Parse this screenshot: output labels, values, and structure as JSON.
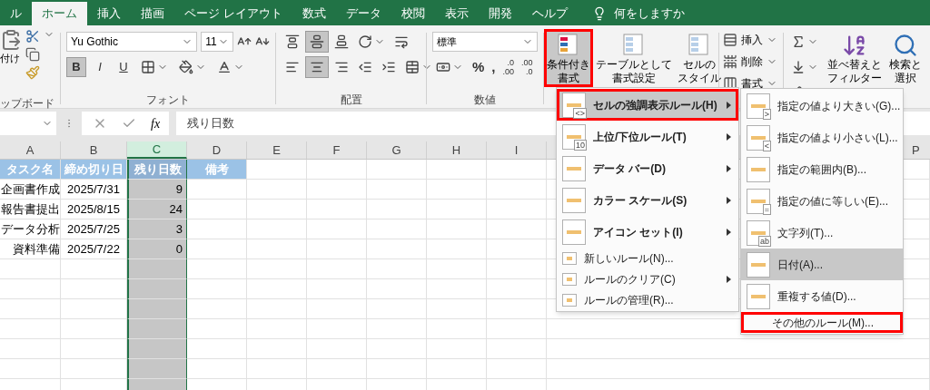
{
  "tabs": [
    {
      "label": "ル",
      "selected": false
    },
    {
      "label": "ホーム",
      "selected": true
    },
    {
      "label": "挿入",
      "selected": false
    },
    {
      "label": "描画",
      "selected": false
    },
    {
      "label": "ページ レイアウト",
      "selected": false
    },
    {
      "label": "数式",
      "selected": false
    },
    {
      "label": "データ",
      "selected": false
    },
    {
      "label": "校閲",
      "selected": false
    },
    {
      "label": "表示",
      "selected": false
    },
    {
      "label": "開発",
      "selected": false
    },
    {
      "label": "ヘルプ",
      "selected": false
    }
  ],
  "tell_me": {
    "placeholder": "何をしますか"
  },
  "ribbon": {
    "clipboard": {
      "paste_label": "付け",
      "group_label": "ップボード"
    },
    "font": {
      "name": "Yu Gothic",
      "size": "11",
      "group_label": "フォント",
      "style_buttons": [
        {
          "label": "B",
          "selected": true
        },
        {
          "label": "I",
          "selected": false
        },
        {
          "label": "U",
          "selected": false
        }
      ]
    },
    "alignment": {
      "group_label": "配置",
      "vertical_buttons": [
        {
          "selected": false
        },
        {
          "selected": true
        },
        {
          "selected": false
        }
      ],
      "horizontal_buttons": [
        {
          "selected": false
        },
        {
          "selected": true
        },
        {
          "selected": false
        }
      ]
    },
    "number": {
      "format": "標準",
      "symbols": [
        "%",
        ","
      ],
      "decimal_buttons": [
        {
          "top": ".0",
          "bottom": ".00"
        },
        {
          "top": ".00",
          "bottom": ".0"
        }
      ],
      "group_label": "数値"
    },
    "styles": [
      {
        "lines": [
          "条件付き",
          "書式"
        ],
        "selected": true,
        "outlined": true
      },
      {
        "lines": [
          "テーブルとして",
          "書式設定"
        ],
        "selected": false,
        "outlined": false
      },
      {
        "lines": [
          "セルの",
          "スタイル"
        ],
        "selected": false,
        "outlined": false
      }
    ],
    "cells": [
      "挿入",
      "削除",
      "書式"
    ],
    "editing": [
      {
        "lines": [
          "並べ替えと",
          "フィルター"
        ]
      },
      {
        "lines": [
          "検索と",
          "選択"
        ]
      }
    ]
  },
  "formula_bar": {
    "fx_label": "fx",
    "value": "残り日数"
  },
  "sheet": {
    "columns": [
      {
        "letter": "A",
        "selected": false
      },
      {
        "letter": "B",
        "selected": false
      },
      {
        "letter": "C",
        "selected": true
      },
      {
        "letter": "D",
        "selected": false
      },
      {
        "letter": "E",
        "selected": false
      },
      {
        "letter": "F",
        "selected": false
      },
      {
        "letter": "G",
        "selected": false
      },
      {
        "letter": "H",
        "selected": false
      },
      {
        "letter": "I",
        "selected": false
      }
    ],
    "last_column": {
      "letter": "P"
    },
    "header_row": [
      "タスク名",
      "締め切り日",
      "残り日数",
      "備考"
    ],
    "rows": [
      [
        "企画書作成",
        "2025/7/31",
        "9"
      ],
      [
        "報告書提出",
        "2025/8/15",
        "24"
      ],
      [
        "データ分析",
        "2025/7/25",
        "3"
      ],
      [
        "資料準備",
        "2025/7/22",
        "0"
      ]
    ]
  },
  "menu": {
    "items": [
      {
        "kind": "main",
        "label": "セルの強調表示ルール(H)",
        "badge": "<>",
        "has_submenu": true,
        "selected": true,
        "outlined": true
      },
      {
        "kind": "main",
        "label": "上位/下位ルール(T)",
        "badge": "10",
        "has_submenu": true,
        "selected": false,
        "outlined": false
      },
      {
        "kind": "main",
        "label": "データ バー(D)",
        "has_submenu": true,
        "selected": false,
        "outlined": false
      },
      {
        "kind": "main",
        "label": "カラー スケール(S)",
        "has_submenu": true,
        "selected": false,
        "outlined": false
      },
      {
        "kind": "main",
        "label": "アイコン セット(I)",
        "has_submenu": true,
        "selected": false,
        "outlined": false
      },
      {
        "kind": "plain",
        "label": "新しいルール(N)...",
        "has_submenu": false,
        "selected": false,
        "outlined": false
      },
      {
        "kind": "plain",
        "label": "ルールのクリア(C)",
        "has_submenu": true,
        "selected": false,
        "outlined": false
      },
      {
        "kind": "plain",
        "label": "ルールの管理(R)...",
        "has_submenu": false,
        "selected": false,
        "outlined": false
      }
    ]
  },
  "submenu": {
    "items": [
      {
        "kind": "main",
        "label": "指定の値より大きい(G)...",
        "badge": ">",
        "selected": false,
        "outlined": false
      },
      {
        "kind": "main",
        "label": "指定の値より小さい(L)...",
        "badge": "<",
        "selected": false,
        "outlined": false
      },
      {
        "kind": "main",
        "label": "指定の範囲内(B)...",
        "selected": false,
        "outlined": false
      },
      {
        "kind": "main",
        "label": "指定の値に等しい(E)...",
        "badge": "=",
        "selected": false,
        "outlined": false
      },
      {
        "kind": "main",
        "label": "文字列(T)...",
        "badge": "ab",
        "selected": false,
        "outlined": false
      },
      {
        "kind": "main",
        "label": "日付(A)...",
        "selected": true,
        "outlined": false
      },
      {
        "kind": "main",
        "label": "重複する値(D)...",
        "selected": false,
        "outlined": false
      },
      {
        "kind": "plain",
        "label": "その他のルール(M)...",
        "selected": false,
        "outlined": true
      }
    ]
  }
}
